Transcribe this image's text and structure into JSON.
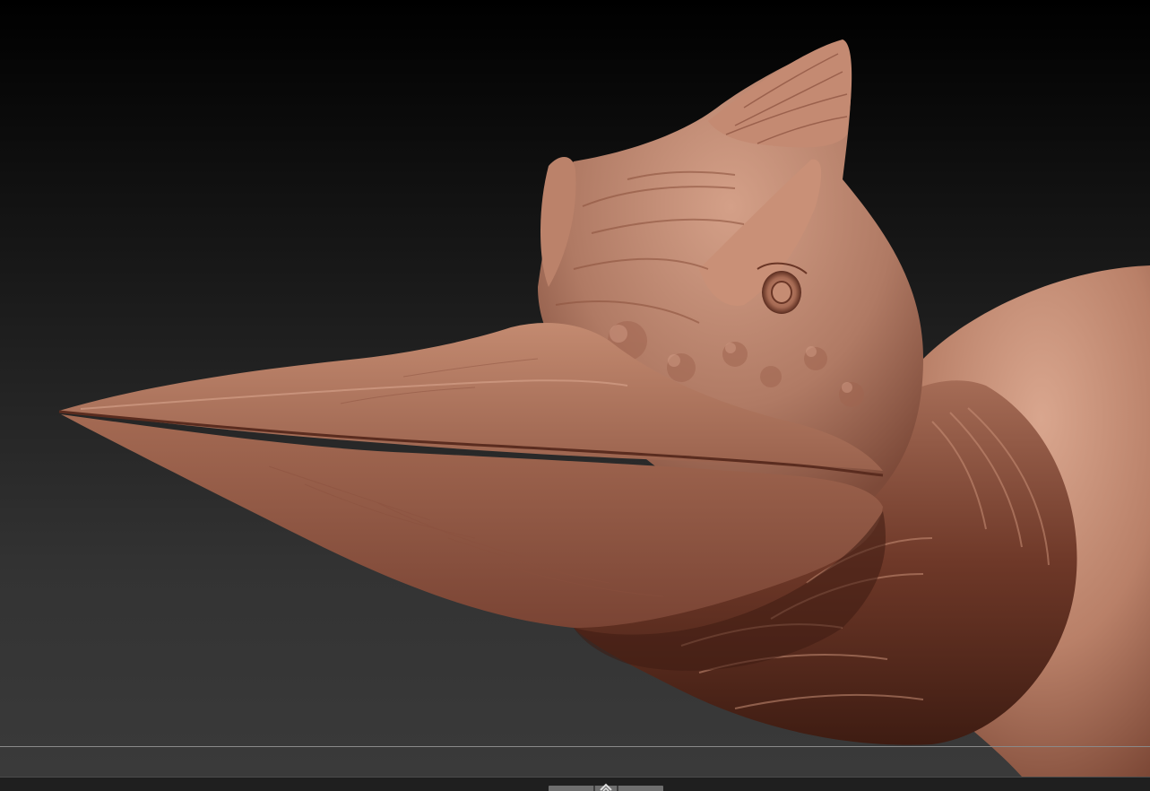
{
  "viewport": {
    "background_top": "#000000",
    "background_bottom": "#3a3a3a",
    "model": {
      "material_color": "#b07a64",
      "shadow_color": "#4a2418",
      "highlight_color": "#e8b49a"
    }
  },
  "bottom_tray": {
    "background": "#1f1f1f",
    "handle_color": "#6e6e6e",
    "arrow_icon": "double-chevron-icon"
  }
}
